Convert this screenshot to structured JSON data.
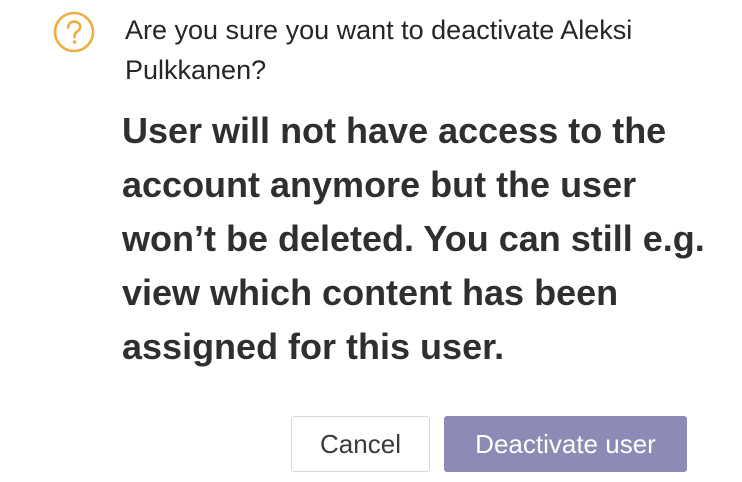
{
  "dialog": {
    "title": "Are you sure you want to deactivate Aleksi Pulkkanen?",
    "message": "User will not have access to the account anymore but the user won’t be deleted. You can still e.g. view which content has been assigned for this user.",
    "icon": "question-circle-icon",
    "icon_color": "#F0AC3C",
    "cancel_label": "Cancel",
    "confirm_label": "Deactivate user",
    "confirm_color": "#8B8BB5"
  }
}
